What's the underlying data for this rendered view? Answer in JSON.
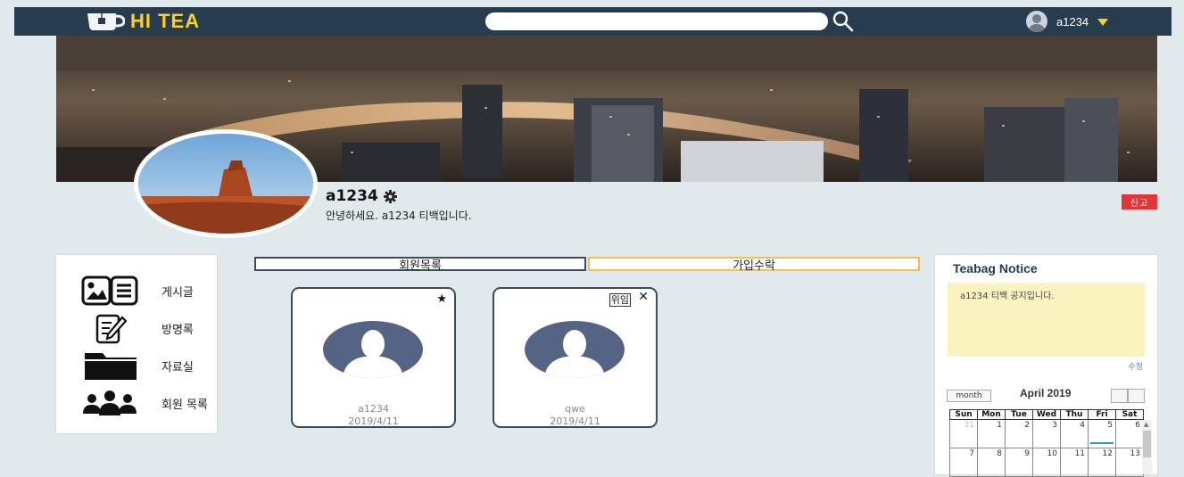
{
  "header": {
    "logo_text": "HI TEA",
    "search_placeholder": "",
    "username": "a1234"
  },
  "profile": {
    "name": "a1234",
    "greeting": "안녕하세요. a1234 티백입니다.",
    "report_label": "신고"
  },
  "sidebar": {
    "items": [
      {
        "label": "게시글",
        "icon": "image-list-icon"
      },
      {
        "label": "방명록",
        "icon": "notepad-pen-icon"
      },
      {
        "label": "자료실",
        "icon": "folder-icon"
      },
      {
        "label": "회원 목록",
        "icon": "group-icon"
      }
    ]
  },
  "tabs": {
    "members": "회원목록",
    "approve": "가입수락"
  },
  "members": [
    {
      "name": "a1234",
      "date": "2019/4/11",
      "badge": "★"
    },
    {
      "name": "qwe",
      "date": "2019/4/11",
      "action": "위임",
      "close": "✕"
    }
  ],
  "notice": {
    "title": "Teabag Notice",
    "content": "a1234 티백 공지입니다.",
    "edit_label": "수정"
  },
  "calendar": {
    "view_button": "month",
    "title": "April 2019",
    "weekdays": [
      "Sun",
      "Mon",
      "Tue",
      "Wed",
      "Thu",
      "Fri",
      "Sat"
    ],
    "row1": [
      "31",
      "1",
      "2",
      "3",
      "4",
      "5",
      "6"
    ],
    "row2": [
      "7",
      "8",
      "9",
      "10",
      "11",
      "12",
      "13"
    ],
    "today": "5"
  },
  "colors": {
    "topbar": "#283c4f",
    "accent_yellow": "#ffd21a",
    "report_red": "#e0363a",
    "notice_bg": "#faf3c0",
    "avatar_blue": "#556484"
  }
}
